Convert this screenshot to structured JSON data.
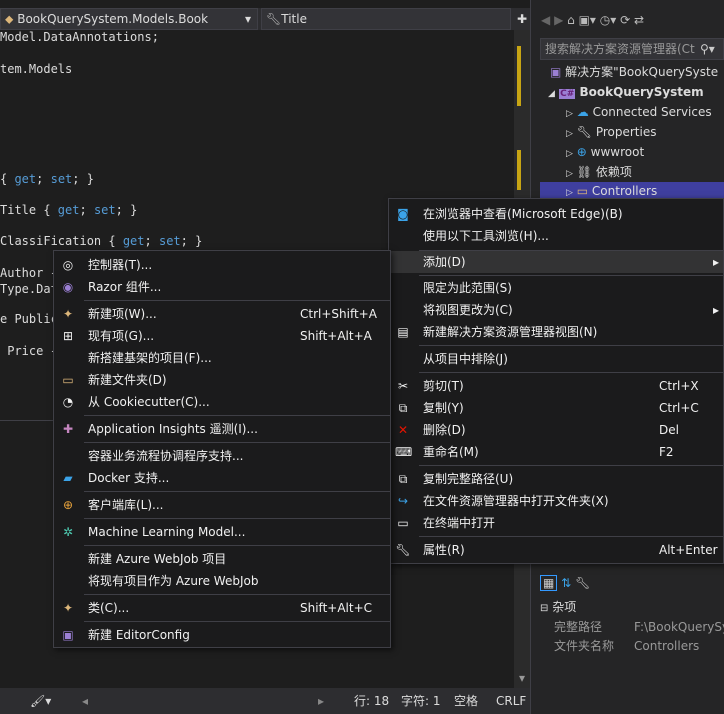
{
  "editor": {
    "nav": {
      "type_dropdown": "BookQuerySystem.Models.Book",
      "member_dropdown": "Title"
    },
    "code_lines": [
      "Model.DataAnnotations;",
      "",
      "",
      "tem.Models",
      "",
      "",
      "",
      "",
      "",
      "{ get; set; }",
      "",
      "Title { get; set; }",
      "",
      "ClassiFication { get; set; }",
      "",
      "Author {",
      "Type.Dat",
      "",
      "e Public",
      "",
      " Price {"
    ],
    "status": {
      "line": "行: 18",
      "char": "字符: 1",
      "spaces": "空格",
      "eol": "CRLF"
    }
  },
  "solution_explorer": {
    "search_placeholder": "搜索解决方案资源管理器(Ct",
    "tree": [
      {
        "label": "解决方案\"BookQuerySyste",
        "icon": "solution-icon",
        "level": 0,
        "expander": ""
      },
      {
        "label": "BookQuerySystem",
        "icon": "csharp-project-icon",
        "level": 1,
        "expander": "◢",
        "bold": true
      },
      {
        "label": "Connected Services",
        "icon": "connected-services-icon",
        "level": 2,
        "expander": "▷"
      },
      {
        "label": "Properties",
        "icon": "properties-icon",
        "level": 2,
        "expander": "▷"
      },
      {
        "label": "wwwroot",
        "icon": "globe-icon",
        "level": 2,
        "expander": "▷"
      },
      {
        "label": "依赖项",
        "icon": "dependencies-icon",
        "level": 2,
        "expander": "▷"
      },
      {
        "label": "Controllers",
        "icon": "folder-icon",
        "level": 2,
        "expander": "▷",
        "selected": true
      }
    ]
  },
  "properties": {
    "category": "杂项",
    "rows": [
      {
        "name": "完整路径",
        "value": "F:\\BookQuerySys"
      },
      {
        "name": "文件夹名称",
        "value": "Controllers"
      }
    ]
  },
  "context_menu": {
    "items": [
      {
        "label": "在浏览器中查看(Microsoft Edge)(B)",
        "shortcut": "",
        "icon": "browser-icon"
      },
      {
        "label": "使用以下工具浏览(H)...",
        "shortcut": "",
        "icon": ""
      },
      {
        "label": "添加(D)",
        "shortcut": "",
        "icon": "",
        "submenu": true,
        "highlighted": true
      },
      {
        "label": "限定为此范围(S)",
        "shortcut": "",
        "icon": ""
      },
      {
        "label": "将视图更改为(C)",
        "shortcut": "",
        "icon": "",
        "submenu": true
      },
      {
        "label": "新建解决方案资源管理器视图(N)",
        "shortcut": "",
        "icon": "new-view-icon"
      },
      {
        "label": "从项目中排除(J)",
        "shortcut": "",
        "icon": ""
      },
      {
        "label": "剪切(T)",
        "shortcut": "Ctrl+X",
        "icon": "cut-icon"
      },
      {
        "label": "复制(Y)",
        "shortcut": "Ctrl+C",
        "icon": "copy-icon"
      },
      {
        "label": "删除(D)",
        "shortcut": "Del",
        "icon": "delete-icon"
      },
      {
        "label": "重命名(M)",
        "shortcut": "F2",
        "icon": "rename-icon"
      },
      {
        "label": "复制完整路径(U)",
        "shortcut": "",
        "icon": "copy-path-icon"
      },
      {
        "label": "在文件资源管理器中打开文件夹(X)",
        "shortcut": "",
        "icon": "open-folder-icon"
      },
      {
        "label": "在终端中打开",
        "shortcut": "",
        "icon": "terminal-icon"
      },
      {
        "label": "属性(R)",
        "shortcut": "Alt+Enter",
        "icon": "wrench-icon"
      }
    ]
  },
  "add_submenu": {
    "items": [
      {
        "label": "控制器(T)...",
        "shortcut": "",
        "icon": "controller-icon"
      },
      {
        "label": "Razor 组件...",
        "shortcut": "",
        "icon": "razor-icon"
      },
      {
        "label": "新建项(W)...",
        "shortcut": "Ctrl+Shift+A",
        "icon": "new-item-icon"
      },
      {
        "label": "现有项(G)...",
        "shortcut": "Shift+Alt+A",
        "icon": "existing-item-icon"
      },
      {
        "label": "新搭建基架的项目(F)...",
        "shortcut": "",
        "icon": ""
      },
      {
        "label": "新建文件夹(D)",
        "shortcut": "",
        "icon": "new-folder-icon"
      },
      {
        "label": "从 Cookiecutter(C)...",
        "shortcut": "",
        "icon": "cookiecutter-icon"
      },
      {
        "label": "Application Insights 遥测(I)...",
        "shortcut": "",
        "icon": "app-insights-icon"
      },
      {
        "label": "容器业务流程协调程序支持...",
        "shortcut": "",
        "icon": ""
      },
      {
        "label": "Docker 支持...",
        "shortcut": "",
        "icon": "docker-icon"
      },
      {
        "label": "客户端库(L)...",
        "shortcut": "",
        "icon": "client-library-icon"
      },
      {
        "label": "Machine Learning Model...",
        "shortcut": "",
        "icon": "ml-model-icon"
      },
      {
        "label": "新建 Azure WebJob 项目",
        "shortcut": "",
        "icon": ""
      },
      {
        "label": "将现有项目作为 Azure WebJob",
        "shortcut": "",
        "icon": ""
      },
      {
        "label": "类(C)...",
        "shortcut": "Shift+Alt+C",
        "icon": "class-icon"
      },
      {
        "label": "新建 EditorConfig",
        "shortcut": "",
        "icon": "editorconfig-icon"
      }
    ]
  }
}
